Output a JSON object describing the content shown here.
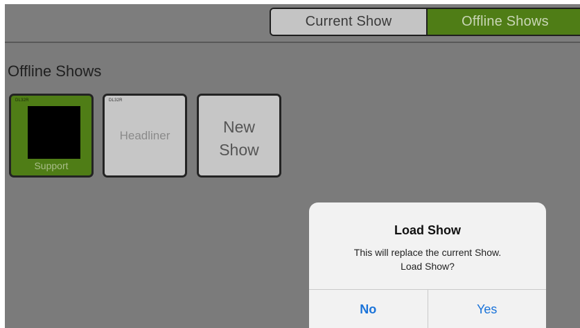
{
  "header": {
    "tabs": [
      {
        "label": "Current Show",
        "selected": false
      },
      {
        "label": "Offline Shows",
        "selected": true
      }
    ]
  },
  "main": {
    "title": "Offline Shows",
    "shows": [
      {
        "tag": "DL32R",
        "label": "Support",
        "selected": true,
        "color": "#4f7d16"
      },
      {
        "tag": "DL32R",
        "label": "Headliner",
        "selected": false
      },
      {
        "label_line1": "New",
        "label_line2": "Show"
      }
    ]
  },
  "dialog": {
    "title": "Load Show",
    "message_line1": "This will replace the current Show.",
    "message_line2": "Load Show?",
    "no_label": "No",
    "yes_label": "Yes",
    "button_color": "#1a73d9"
  },
  "colors": {
    "accent_green": "#4f7d16",
    "background": "#7b7b7b"
  }
}
